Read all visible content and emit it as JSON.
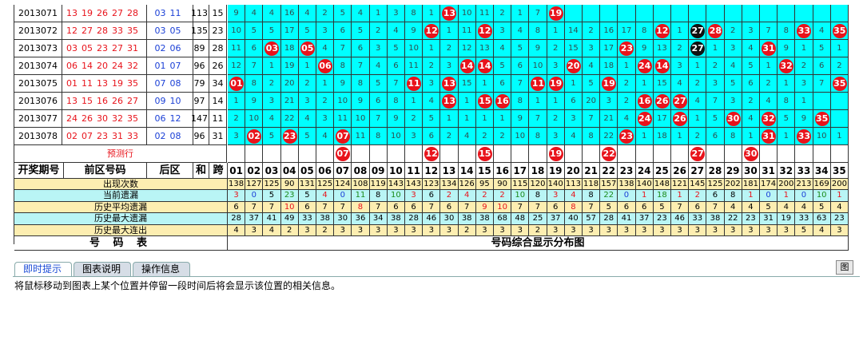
{
  "colors": {
    "cyan": "#00ffff",
    "red_ball": "#e8131b",
    "black_ball": "#111111",
    "issue_red": "#e8131b",
    "issue_blue": "#1a3fd6"
  },
  "draws": [
    {
      "issue": "2013071",
      "front": [
        "13",
        "19",
        "26",
        "27",
        "28"
      ],
      "back": [
        "03",
        "11"
      ],
      "sum": "113",
      "span": "15",
      "cells": [
        "9",
        "4",
        "4",
        "16",
        "4",
        "2",
        "5",
        "4",
        "1",
        "3",
        "8",
        "1",
        "13",
        "10",
        "11",
        "2",
        "1",
        "7",
        "19",
        "",
        "",
        "",
        "",
        "",
        "",
        "",
        "",
        "",
        "",
        "",
        "",
        "",
        "",
        "",
        ""
      ]
    },
    {
      "issue": "2013072",
      "front": [
        "12",
        "27",
        "28",
        "33",
        "35"
      ],
      "back": [
        "03",
        "05"
      ],
      "sum": "135",
      "span": "23",
      "cells": [
        "10",
        "5",
        "5",
        "17",
        "5",
        "3",
        "6",
        "5",
        "2",
        "4",
        "9",
        "12",
        "1",
        "11",
        "12",
        "3",
        "4",
        "8",
        "1",
        "14",
        "2",
        "16",
        "17",
        "8",
        "12",
        "1",
        "27",
        "28",
        "2",
        "3",
        "7",
        "8",
        "33",
        "4",
        "35"
      ]
    },
    {
      "issue": "2013073",
      "front": [
        "03",
        "05",
        "23",
        "27",
        "31"
      ],
      "back": [
        "02",
        "06"
      ],
      "sum": "89",
      "span": "28",
      "cells": [
        "11",
        "6",
        "03",
        "18",
        "05",
        "4",
        "7",
        "6",
        "3",
        "5",
        "10",
        "1",
        "2",
        "12",
        "13",
        "4",
        "5",
        "9",
        "2",
        "15",
        "3",
        "17",
        "23",
        "9",
        "13",
        "2",
        "27",
        "1",
        "3",
        "4",
        "31",
        "9",
        "1",
        "5",
        "1"
      ]
    },
    {
      "issue": "2013074",
      "front": [
        "06",
        "14",
        "20",
        "24",
        "32"
      ],
      "back": [
        "01",
        "07"
      ],
      "sum": "96",
      "span": "26",
      "cells": [
        "12",
        "7",
        "1",
        "19",
        "1",
        "06",
        "8",
        "7",
        "4",
        "6",
        "11",
        "2",
        "3",
        "14",
        "14",
        "5",
        "6",
        "10",
        "3",
        "20",
        "4",
        "18",
        "1",
        "24",
        "14",
        "3",
        "1",
        "2",
        "4",
        "5",
        "1",
        "32",
        "2",
        "6",
        "2"
      ]
    },
    {
      "issue": "2013075",
      "front": [
        "01",
        "11",
        "13",
        "19",
        "35"
      ],
      "back": [
        "07",
        "08"
      ],
      "sum": "79",
      "span": "34",
      "cells": [
        "01",
        "8",
        "2",
        "20",
        "2",
        "1",
        "9",
        "8",
        "5",
        "7",
        "11",
        "3",
        "13",
        "15",
        "1",
        "6",
        "7",
        "11",
        "19",
        "1",
        "5",
        "19",
        "2",
        "1",
        "15",
        "4",
        "2",
        "3",
        "5",
        "6",
        "2",
        "1",
        "3",
        "7",
        "35"
      ]
    },
    {
      "issue": "2013076",
      "front": [
        "13",
        "15",
        "16",
        "26",
        "27"
      ],
      "back": [
        "09",
        "10"
      ],
      "sum": "97",
      "span": "14",
      "cells": [
        "1",
        "9",
        "3",
        "21",
        "3",
        "2",
        "10",
        "9",
        "6",
        "8",
        "1",
        "4",
        "13",
        "1",
        "15",
        "16",
        "8",
        "1",
        "1",
        "6",
        "20",
        "3",
        "2",
        "16",
        "26",
        "27",
        "4",
        "7",
        "3",
        "2",
        "4",
        "8",
        "1"
      ]
    },
    {
      "issue": "2013077",
      "front": [
        "24",
        "26",
        "30",
        "32",
        "35"
      ],
      "back": [
        "06",
        "12"
      ],
      "sum": "147",
      "span": "11",
      "cells": [
        "2",
        "10",
        "4",
        "22",
        "4",
        "3",
        "11",
        "10",
        "7",
        "9",
        "2",
        "5",
        "1",
        "1",
        "1",
        "1",
        "9",
        "7",
        "2",
        "3",
        "7",
        "21",
        "4",
        "24",
        "17",
        "26",
        "1",
        "5",
        "30",
        "4",
        "32",
        "5",
        "9",
        "35"
      ]
    },
    {
      "issue": "2013078",
      "front": [
        "02",
        "07",
        "23",
        "31",
        "33"
      ],
      "back": [
        "02",
        "08"
      ],
      "sum": "96",
      "span": "31",
      "cells": [
        "3",
        "02",
        "5",
        "23",
        "5",
        "4",
        "07",
        "11",
        "8",
        "10",
        "3",
        "6",
        "2",
        "4",
        "2",
        "2",
        "10",
        "8",
        "3",
        "4",
        "8",
        "22",
        "23",
        "1",
        "18",
        "1",
        "2",
        "6",
        "8",
        "1",
        "31",
        "1",
        "33",
        "10",
        "1"
      ]
    }
  ],
  "predict": {
    "label": "预测行",
    "balls": [
      "07",
      "12",
      "15",
      "19",
      "22",
      "27",
      "30"
    ]
  },
  "headers": {
    "issue": "开奖期号",
    "front": "前区号码",
    "back": "后区",
    "sum": "和",
    "span": "跨",
    "numbers": [
      "01",
      "02",
      "03",
      "04",
      "05",
      "06",
      "07",
      "08",
      "09",
      "10",
      "11",
      "12",
      "13",
      "14",
      "15",
      "16",
      "17",
      "18",
      "19",
      "20",
      "21",
      "22",
      "23",
      "24",
      "25",
      "26",
      "27",
      "28",
      "29",
      "30",
      "31",
      "32",
      "33",
      "34",
      "35"
    ]
  },
  "stats": [
    {
      "label": "出现次数",
      "values": [
        "138",
        "127",
        "125",
        "90",
        "131",
        "125",
        "124",
        "108",
        "119",
        "143",
        "143",
        "123",
        "134",
        "126",
        "95",
        "90",
        "115",
        "120",
        "140",
        "113",
        "118",
        "157",
        "138",
        "140",
        "148",
        "121",
        "145",
        "125",
        "202",
        "181",
        "174",
        "200",
        "213",
        "169",
        "200"
      ]
    },
    {
      "label": "当前遗漏",
      "values": [
        "3",
        "0",
        "5",
        "23",
        "5",
        "4",
        "0",
        "11",
        "8",
        "10",
        "3",
        "6",
        "2",
        "4",
        "2",
        "2",
        "10",
        "8",
        "3",
        "4",
        "8",
        "22",
        "0",
        "1",
        "18",
        "1",
        "2",
        "6",
        "8",
        "1",
        "0",
        "1",
        "0",
        "10",
        "1"
      ]
    },
    {
      "label": "历史平均遗漏",
      "values": [
        "6",
        "7",
        "7",
        "10",
        "6",
        "7",
        "7",
        "8",
        "7",
        "6",
        "6",
        "7",
        "6",
        "7",
        "9",
        "10",
        "7",
        "7",
        "6",
        "8",
        "7",
        "5",
        "6",
        "6",
        "5",
        "7",
        "6",
        "7",
        "4",
        "4",
        "5",
        "4",
        "4",
        "5",
        "4"
      ]
    },
    {
      "label": "历史最大遗漏",
      "values": [
        "28",
        "37",
        "41",
        "49",
        "33",
        "38",
        "30",
        "36",
        "34",
        "38",
        "28",
        "46",
        "30",
        "38",
        "38",
        "68",
        "48",
        "25",
        "37",
        "40",
        "57",
        "28",
        "41",
        "37",
        "23",
        "46",
        "33",
        "38",
        "22",
        "23",
        "31",
        "19",
        "33",
        "63",
        "23"
      ]
    },
    {
      "label": "历史最大连出",
      "values": [
        "4",
        "3",
        "4",
        "2",
        "3",
        "2",
        "3",
        "3",
        "3",
        "3",
        "3",
        "3",
        "3",
        "2",
        "3",
        "3",
        "3",
        "2",
        "3",
        "3",
        "3",
        "3",
        "3",
        "3",
        "3",
        "3",
        "3",
        "3",
        "3",
        "3",
        "3",
        "3",
        "5",
        "4",
        "3",
        "5",
        "4"
      ]
    }
  ],
  "footer": {
    "left": "号 码 表",
    "right": "号码综合显示分布图"
  },
  "tabs": [
    "即时提示",
    "图表说明",
    "操作信息"
  ],
  "message": "将鼠标移动到图表上某个位置并停留一段时间后将会显示该位置的相关信息。",
  "corner_button": "图"
}
